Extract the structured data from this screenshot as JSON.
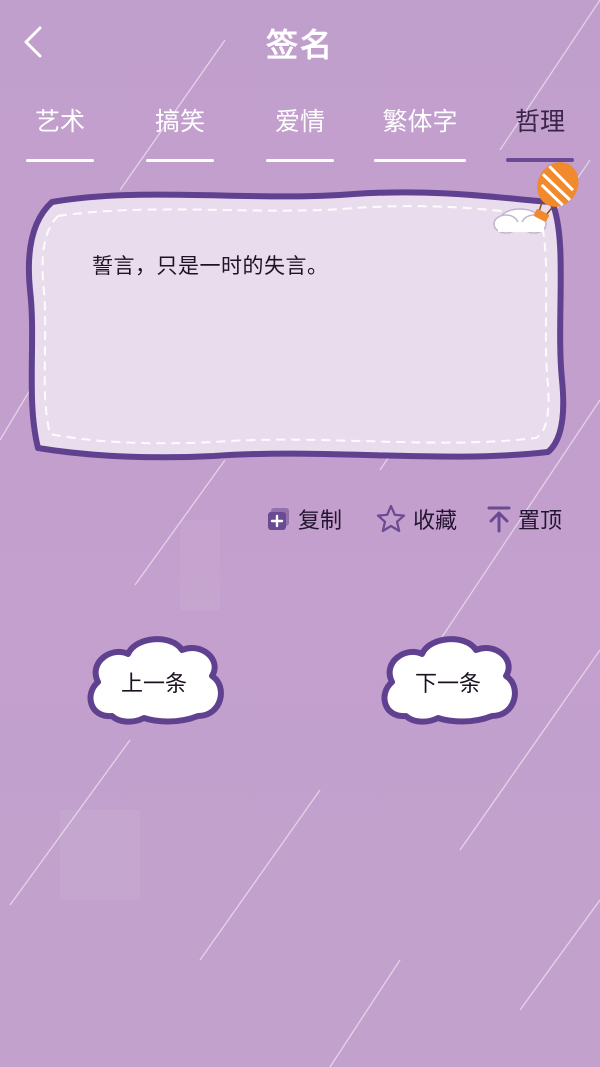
{
  "header": {
    "title": "签名",
    "back_icon": "chevron-left-icon"
  },
  "tabs": [
    {
      "label": "艺术",
      "active": false
    },
    {
      "label": "搞笑",
      "active": false
    },
    {
      "label": "爱情",
      "active": false
    },
    {
      "label": "繁体字",
      "active": false
    },
    {
      "label": "哲理",
      "active": true
    }
  ],
  "card": {
    "text": "誓言，只是一时的失言。"
  },
  "actions": {
    "copy_label": "复制",
    "favorite_label": "收藏",
    "pin_label": "置顶"
  },
  "nav": {
    "prev_label": "上一条",
    "next_label": "下一条"
  },
  "colors": {
    "background": "#c19fcd",
    "accent": "#6a4a92",
    "card_fill": "#e9dcec",
    "card_border": "#5f4190",
    "balloon": "#f08a2c"
  }
}
